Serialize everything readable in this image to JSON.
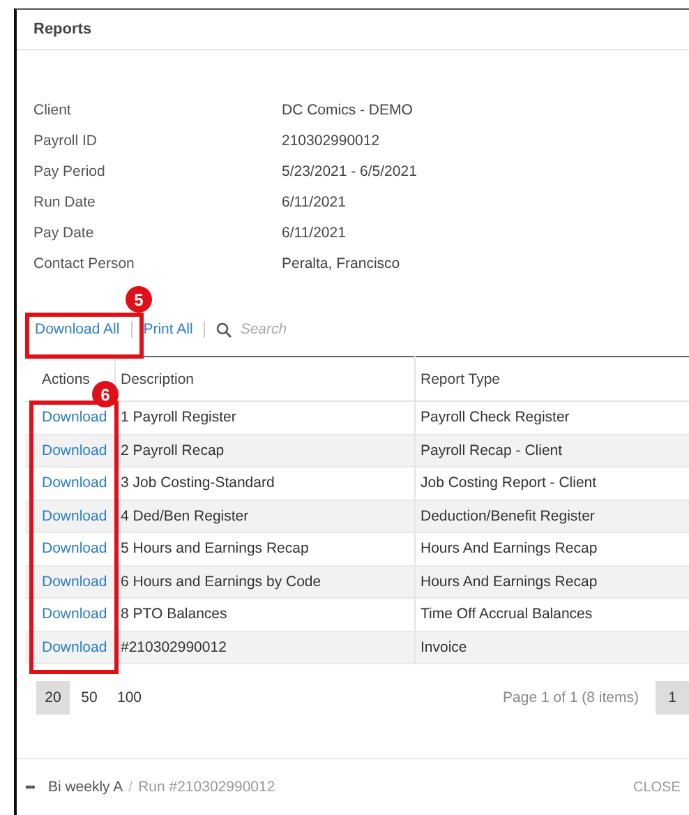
{
  "dialog": {
    "title": "Reports"
  },
  "details": [
    {
      "label": "Client",
      "value": "DC Comics - DEMO"
    },
    {
      "label": "Payroll ID",
      "value": "210302990012"
    },
    {
      "label": "Pay Period",
      "value": "5/23/2021 - 6/5/2021"
    },
    {
      "label": "Run Date",
      "value": "6/11/2021"
    },
    {
      "label": "Pay Date",
      "value": "6/11/2021"
    },
    {
      "label": "Contact Person",
      "value": "Peralta, Francisco"
    }
  ],
  "toolbar": {
    "actions": [
      {
        "label": "Download All",
        "callout": "5"
      },
      {
        "label": "Print All"
      }
    ],
    "search": {
      "placeholder": "Search"
    }
  },
  "table": {
    "columns": [
      {
        "label": "Actions",
        "callout": "6"
      },
      {
        "label": "Description"
      },
      {
        "label": "Report Type"
      }
    ],
    "rows": [
      {
        "action": "Download",
        "description": "1 Payroll Register",
        "report_type": "Payroll Check Register"
      },
      {
        "action": "Download",
        "description": "2 Payroll Recap",
        "report_type": "Payroll Recap - Client"
      },
      {
        "action": "Download",
        "description": "3 Job Costing-Standard",
        "report_type": "Job Costing Report - Client"
      },
      {
        "action": "Download",
        "description": "4 Ded/Ben Register",
        "report_type": "Deduction/Benefit Register"
      },
      {
        "action": "Download",
        "description": "5 Hours and Earnings Recap",
        "report_type": "Hours And Earnings Recap"
      },
      {
        "action": "Download",
        "description": "6 Hours and Earnings by Code",
        "report_type": "Hours And Earnings Recap"
      },
      {
        "action": "Download",
        "description": "8 PTO Balances",
        "report_type": "Time Off Accrual Balances"
      },
      {
        "action": "Download",
        "description": "#210302990012",
        "report_type": "Invoice"
      }
    ]
  },
  "pager": {
    "page_sizes": [
      {
        "label": "20",
        "selected": true
      },
      {
        "label": "50",
        "selected": false
      },
      {
        "label": "100",
        "selected": false
      }
    ],
    "summary": "Page 1 of 1 (8 items)",
    "pages": [
      {
        "label": "1",
        "selected": true
      }
    ]
  },
  "footer": {
    "menu": "•••",
    "breadcrumb": "Bi weekly A",
    "separator": "/",
    "run": "Run #210302990012",
    "close": "CLOSE"
  }
}
